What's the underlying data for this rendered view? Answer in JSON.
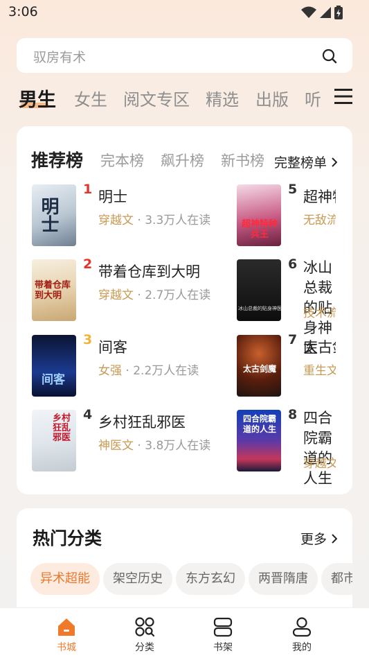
{
  "status_bar": {
    "time": "3:06"
  },
  "search": {
    "placeholder": "驭房有术"
  },
  "channels": [
    "男生",
    "女生",
    "阅文专区",
    "精选",
    "出版",
    "听"
  ],
  "ranking": {
    "tabs": [
      "推荐榜",
      "完本榜",
      "飙升榜",
      "新书榜"
    ],
    "full_list_label": "完整榜单",
    "books": [
      {
        "rank": "1",
        "title": "明士",
        "tag": "穿越文",
        "readers": "3.3万人在读",
        "cover_text": "明士"
      },
      {
        "rank": "2",
        "title": "带着仓库到大明",
        "tag": "穿越文",
        "readers": "2.7万人在读",
        "cover_text": "带着仓库到大明"
      },
      {
        "rank": "3",
        "title": "间客",
        "tag": "女强",
        "readers": "2.2万人在读",
        "cover_text": "间客"
      },
      {
        "rank": "4",
        "title": "乡村狂乱邪医",
        "tag": "神医文",
        "readers": "3.8万人在读",
        "cover_text": "乡村狂乱邪医"
      },
      {
        "rank": "5",
        "title": "超神特种兵王",
        "tag": "无敌流",
        "readers": "",
        "cover_text": "超神特种兵王"
      },
      {
        "rank": "6",
        "title": "冰山总裁的贴身神医",
        "tag": "技术流",
        "readers": "",
        "cover_text": "冰山总裁的贴身神医"
      },
      {
        "rank": "7",
        "title": "太古剑魔",
        "tag": "重生文",
        "readers": "",
        "cover_text": "太古剑魔"
      },
      {
        "rank": "8",
        "title": "四合院霸道的人生",
        "tag": "穿越文",
        "readers": "",
        "cover_text": "四合院霸道的人生"
      }
    ]
  },
  "hot_categories": {
    "title": "热门分类",
    "more_label": "更多",
    "chips": [
      "异术超能",
      "架空历史",
      "东方玄幻",
      "两晋隋唐",
      "都市"
    ]
  },
  "bottom_nav": [
    "书城",
    "分类",
    "书架",
    "我的"
  ],
  "colors": {
    "accent": "#f07a2a",
    "rank_red": "#e5322d",
    "rank_gold": "#f1b338",
    "rank_dark": "#333333",
    "tag": "#c79a55"
  }
}
